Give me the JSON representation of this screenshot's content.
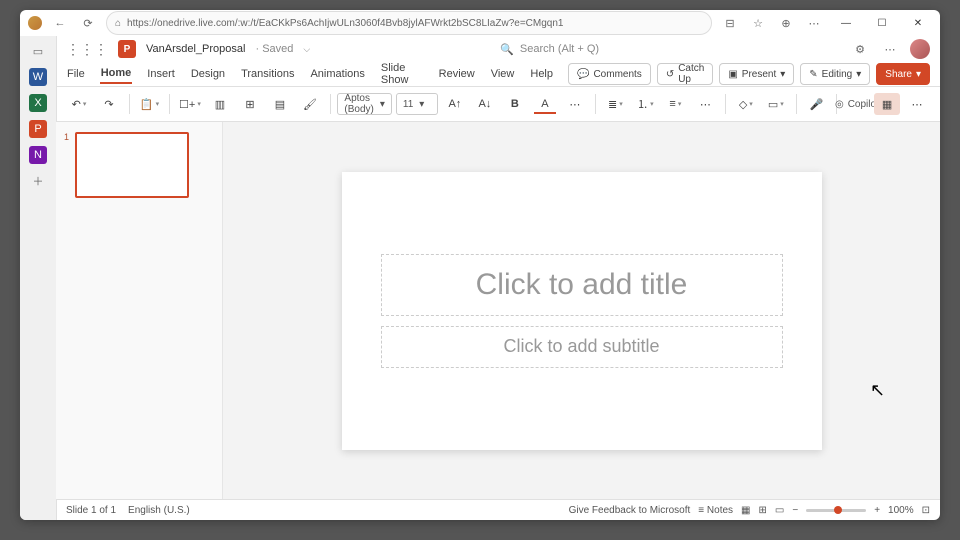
{
  "browser": {
    "url": "https://onedrive.live.com/:w:/t/EaCKkPs6AchIjwULn3060f4Bvb8jylAFWrkt2bSC8LIaZw?e=CMgqn1"
  },
  "sidebar_apps": {
    "word": "W",
    "excel": "X",
    "ppt": "P",
    "onenote": "N",
    "add": "＋"
  },
  "header": {
    "doc_name": "VanArsdel_Proposal",
    "save_status": "· Saved",
    "search_placeholder": "Search (Alt + Q)"
  },
  "tabs": {
    "file": "File",
    "home": "Home",
    "insert": "Insert",
    "design": "Design",
    "transitions": "Transitions",
    "animations": "Animations",
    "slideshow": "Slide Show",
    "review": "Review",
    "view": "View",
    "help": "Help"
  },
  "actions": {
    "comments": "Comments",
    "catchup": "Catch Up",
    "present": "Present",
    "editing": "Editing",
    "share": "Share"
  },
  "ribbon": {
    "font": "Aptos (Body)",
    "size": "11",
    "bold": "B",
    "fontcolor": "A",
    "copilot": "Copilot"
  },
  "thumb": {
    "num": "1"
  },
  "slide": {
    "title_ph": "Click to add title",
    "sub_ph": "Click to add subtitle"
  },
  "status": {
    "slide": "Slide 1 of 1",
    "lang": "English (U.S.)",
    "feedback": "Give Feedback to Microsoft",
    "notes": "Notes",
    "zoom": "100%",
    "minus": "−",
    "plus": "+"
  }
}
